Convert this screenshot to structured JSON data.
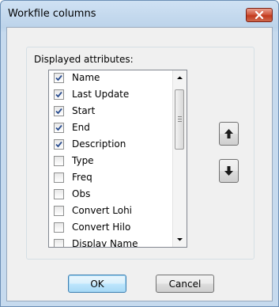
{
  "window": {
    "title": "Workfile columns"
  },
  "group": {
    "label": "Displayed attributes:"
  },
  "attributes": [
    {
      "label": "Name",
      "checked": true
    },
    {
      "label": "Last Update",
      "checked": true
    },
    {
      "label": "Start",
      "checked": true
    },
    {
      "label": "End",
      "checked": true
    },
    {
      "label": "Description",
      "checked": true
    },
    {
      "label": "Type",
      "checked": false
    },
    {
      "label": "Freq",
      "checked": false
    },
    {
      "label": "Obs",
      "checked": false
    },
    {
      "label": "Convert Lohi",
      "checked": false
    },
    {
      "label": "Convert Hilo",
      "checked": false
    },
    {
      "label": "Display Name",
      "checked": false
    }
  ],
  "buttons": {
    "ok": "OK",
    "cancel": "Cancel"
  },
  "icons": {
    "close": "close-icon",
    "move_up": "arrow-up-icon",
    "move_down": "arrow-down-icon",
    "check": "checkmark-icon"
  },
  "colors": {
    "close_button": "#c23a1d",
    "default_button_border": "#3c7fb1",
    "check": "#2a4d8f"
  }
}
